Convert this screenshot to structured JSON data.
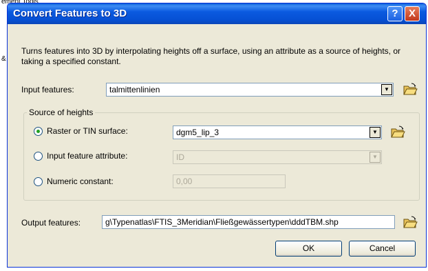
{
  "background": {
    "line1": "ement Tools",
    "line2": "&"
  },
  "dialog": {
    "title": "Convert Features to 3D",
    "help_label": "?",
    "close_label": "X",
    "description": "Turns features into 3D by interpolating heights off a surface, using an attribute as a source of heights, or taking a specified constant.",
    "input_features": {
      "label": "Input features:",
      "value": "talmittenlinien"
    },
    "source_of_heights": {
      "title": "Source of heights",
      "raster": {
        "label": "Raster or TIN surface:",
        "value": "dgm5_lip_3",
        "selected": true
      },
      "attribute": {
        "label": "Input feature attribute:",
        "value": "ID",
        "selected": false
      },
      "constant": {
        "label": "Numeric constant:",
        "value": "0,00",
        "selected": false
      }
    },
    "output_features": {
      "label": "Output features:",
      "value": "g\\Typenatlas\\FTIS_3Meridian\\Fließgewässertypen\\dddTBM.shp"
    },
    "ok_label": "OK",
    "cancel_label": "Cancel"
  },
  "colors": {
    "titlebar": "#0650d3",
    "dialog_bg": "#ece9d8",
    "close": "#c2381b"
  },
  "icons": [
    "open-folder-icon",
    "dropdown-arrow-icon",
    "help-icon",
    "close-icon"
  ]
}
